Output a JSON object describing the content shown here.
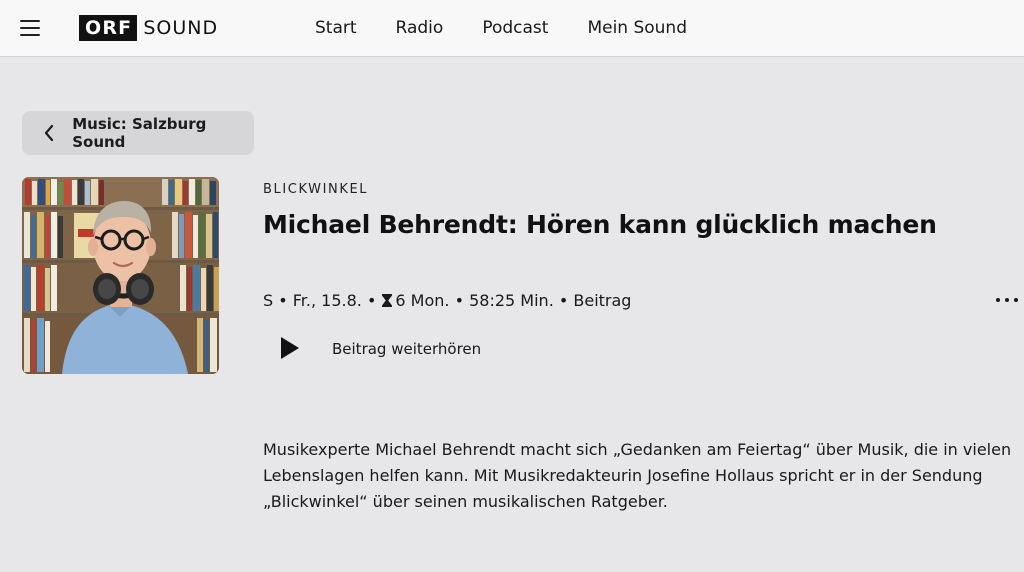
{
  "header": {
    "logo_primary": "ORF",
    "logo_secondary": "SOUND",
    "nav": [
      "Start",
      "Radio",
      "Podcast",
      "Mein Sound"
    ]
  },
  "back_button": {
    "label": "Music: Salzburg Sound"
  },
  "episode": {
    "category": "BLICKWINKEL",
    "title": "Michael Behrendt: Hören kann glücklich machen",
    "meta_prefix": "S • Fr., 15.8. •",
    "meta_suffix": "6 Mon. • 58:25 Min. • Beitrag",
    "play_label": "Beitrag weiterhören",
    "description": "Musikexperte Michael Behrendt macht sich „Gedanken am Feiertag“ über Musik, die in vielen Lebenslagen helfen kann. Mit Musikredakteurin Josefine Hollaus spricht er in der Sendung „Blickwinkel“ über seinen musikalischen Ratgeber."
  },
  "icons": {
    "menu": "hamburger-icon",
    "back": "chevron-left-icon",
    "availability": "hourglass-icon",
    "more": "more-dots-icon",
    "play": "play-icon"
  }
}
